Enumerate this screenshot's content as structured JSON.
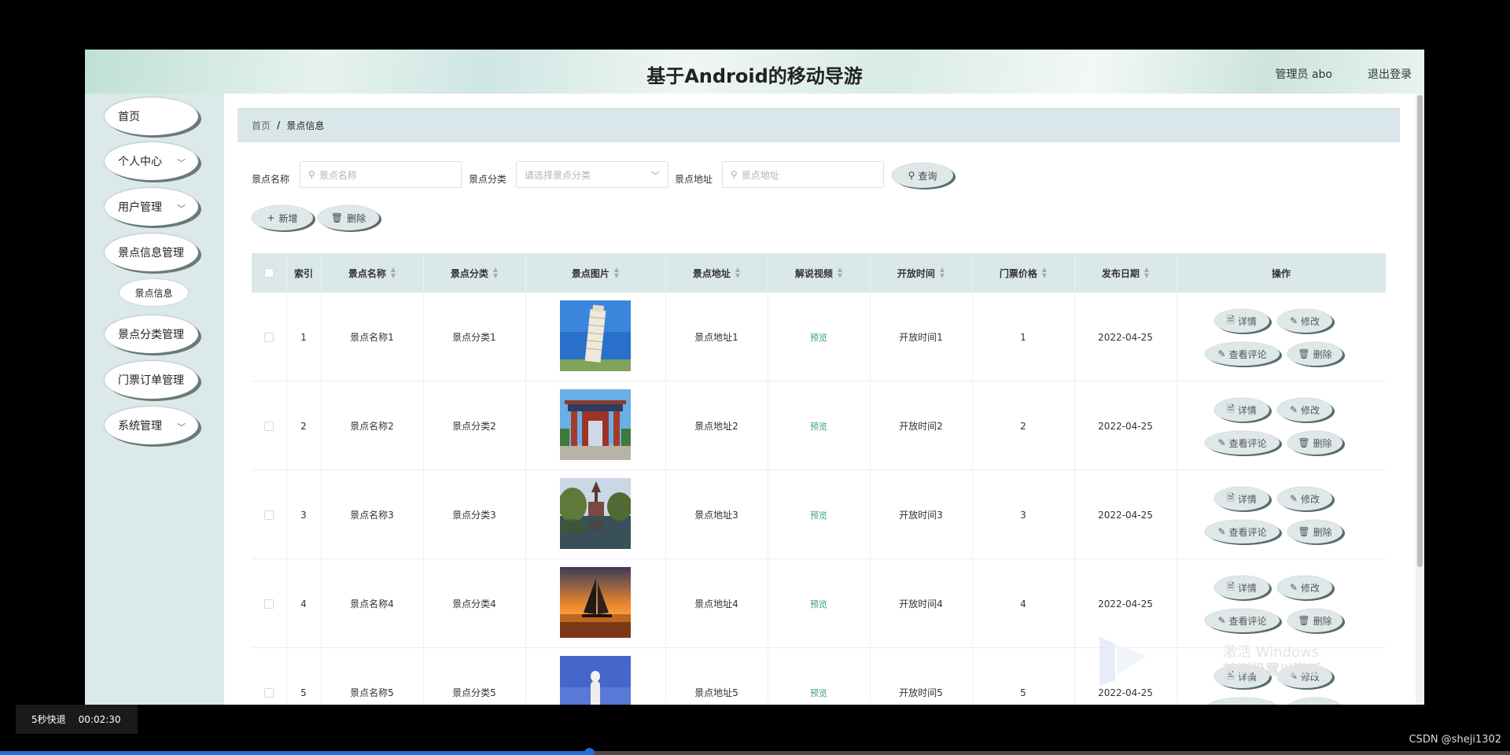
{
  "app": {
    "title": "基于Android的移动导游",
    "admin_label": "管理员 abo",
    "logout_label": "退出登录"
  },
  "sidebar": {
    "items": [
      {
        "label": "首页",
        "has_children": false
      },
      {
        "label": "个人中心",
        "has_children": true
      },
      {
        "label": "用户管理",
        "has_children": true
      },
      {
        "label": "景点信息管理",
        "has_children": false
      },
      {
        "label": "景点分类管理",
        "has_children": false
      },
      {
        "label": "门票订单管理",
        "has_children": false
      },
      {
        "label": "系统管理",
        "has_children": true
      }
    ],
    "sub_item": "景点信息"
  },
  "breadcrumb": {
    "home": "首页",
    "separator": "/",
    "current": "景点信息"
  },
  "filters": {
    "name_label": "景点名称",
    "name_placeholder": "景点名称",
    "category_label": "景点分类",
    "category_placeholder": "请选择景点分类",
    "address_label": "景点地址",
    "address_placeholder": "景点地址",
    "query_button": "查询"
  },
  "toolbar": {
    "add_button": "新增",
    "delete_button": "删除"
  },
  "table": {
    "columns": [
      "索引",
      "景点名称",
      "景点分类",
      "景点图片",
      "景点地址",
      "解说视频",
      "开放时间",
      "门票价格",
      "发布日期",
      "操作"
    ],
    "preview_label": "预览",
    "actions": {
      "detail": "详情",
      "edit": "修改",
      "reviews": "查看评论",
      "delete": "删除"
    },
    "rows": [
      {
        "index": "1",
        "name": "景点名称1",
        "category": "景点分类1",
        "image": "leaning-tower",
        "address": "景点地址1",
        "open_time": "开放时间1",
        "price": "1",
        "date": "2022-04-25"
      },
      {
        "index": "2",
        "name": "景点名称2",
        "category": "景点分类2",
        "image": "chinese-gate",
        "address": "景点地址2",
        "open_time": "开放时间2",
        "price": "2",
        "date": "2022-04-25"
      },
      {
        "index": "3",
        "name": "景点名称3",
        "category": "景点分类3",
        "image": "lake-church",
        "address": "景点地址3",
        "open_time": "开放时间3",
        "price": "3",
        "date": "2022-04-25"
      },
      {
        "index": "4",
        "name": "景点名称4",
        "category": "景点分类4",
        "image": "sunset-sailboat",
        "address": "景点地址4",
        "open_time": "开放时间4",
        "price": "4",
        "date": "2022-04-25"
      },
      {
        "index": "5",
        "name": "景点名称5",
        "category": "景点分类5",
        "image": "white-statue",
        "address": "景点地址5",
        "open_time": "开放时间5",
        "price": "5",
        "date": "2022-04-25"
      }
    ]
  },
  "watermark": {
    "line1": "激活 Windows",
    "line2": "转到设置以激活"
  },
  "player": {
    "skip_label": "5秒快退",
    "time": "00:02:30",
    "progress": 0.39
  },
  "credit": "CSDN @sheji1302",
  "colors": {
    "accent_green": "#3aa17e",
    "header_bg": "#dbe8ea",
    "progress_blue": "#1e6fd9"
  }
}
